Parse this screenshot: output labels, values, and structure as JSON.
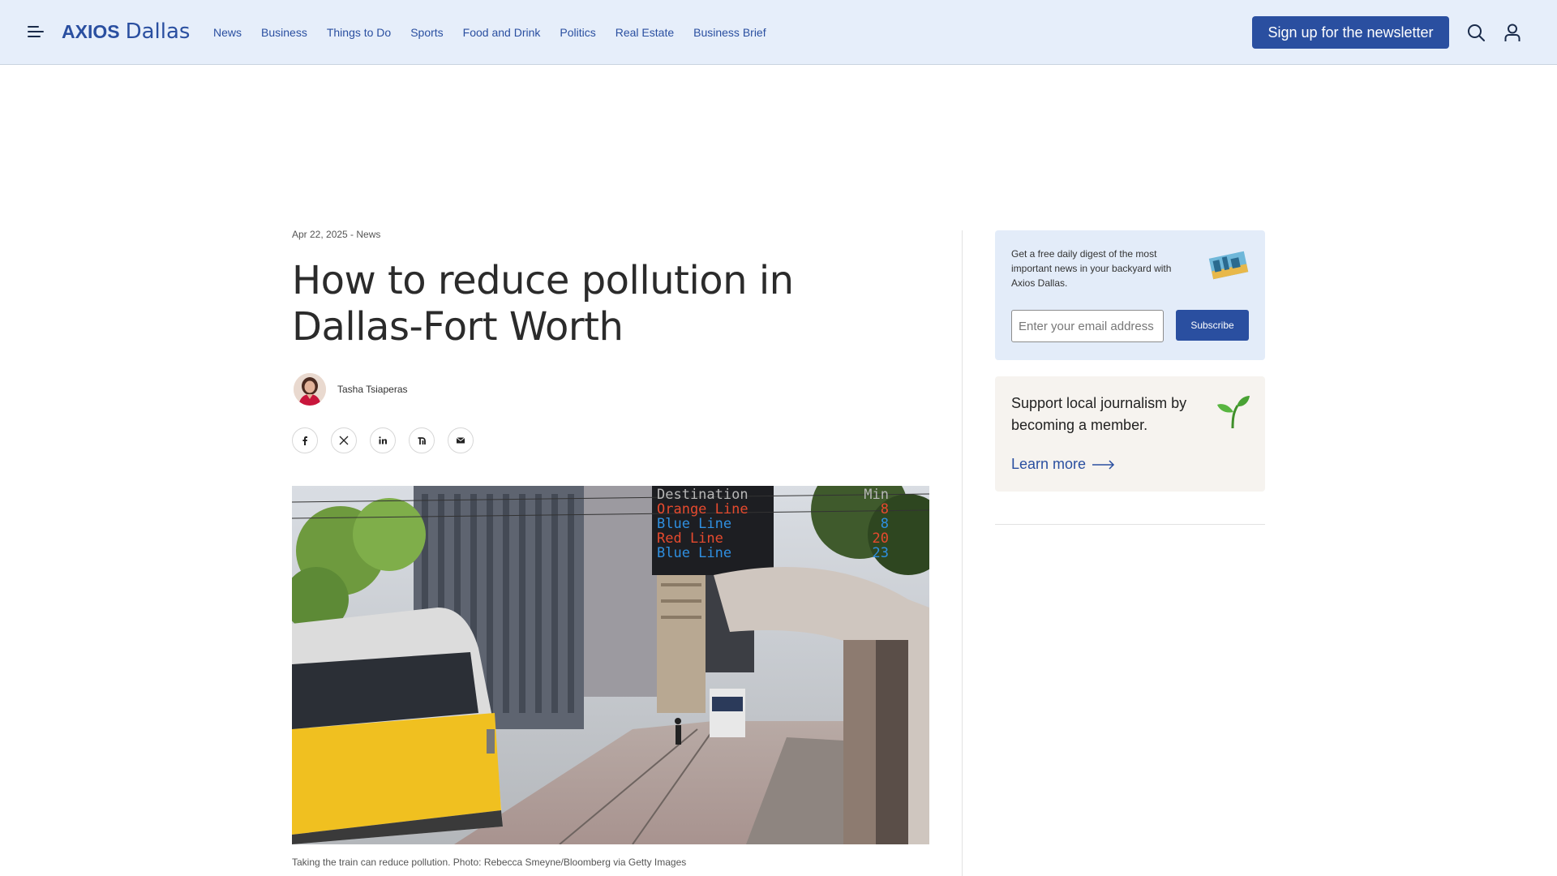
{
  "header": {
    "logo_brand": "AXIOS",
    "logo_city": "Dallas",
    "nav": [
      "News",
      "Business",
      "Things to Do",
      "Sports",
      "Food and Drink",
      "Politics",
      "Real Estate",
      "Business Brief"
    ],
    "signup_label": "Sign up for the newsletter",
    "icons": [
      "menu-icon",
      "search-icon",
      "user-icon"
    ]
  },
  "article": {
    "date": "Apr 22, 2025",
    "separator": " - ",
    "section": "News",
    "title": "How to reduce pollution in Dallas-Fort Worth",
    "author": "Tasha Tsiaperas",
    "share_icons": [
      "facebook-icon",
      "x-icon",
      "linkedin-icon",
      "threads-icon",
      "email-icon"
    ],
    "caption": "Taking the train can reduce pollution. Photo: Rebecca Smeyne/Bloomberg via Getty Images",
    "image_board": {
      "header": "Destination",
      "header_right": "Min",
      "rows": [
        {
          "line": "Orange Line",
          "min": "8",
          "color": "#e64a2e"
        },
        {
          "line": "Blue Line",
          "min": "8",
          "color": "#2f8fe0"
        },
        {
          "line": "Red Line",
          "min": "20",
          "color": "#e64a2e"
        },
        {
          "line": "Blue Line",
          "min": "23",
          "color": "#2f8fe0"
        }
      ]
    }
  },
  "sidebar": {
    "newsletter": {
      "text": "Get a free daily digest of the most important news in your backyard with Axios Dallas.",
      "input_placeholder": "Enter your email address",
      "button": "Subscribe"
    },
    "membership": {
      "text": "Support local journalism by becoming a member.",
      "link": "Learn more"
    }
  },
  "colors": {
    "brand": "#2a4fa0",
    "header_bg": "#e6eefa",
    "newsletter_bg": "#e3ecf9",
    "member_bg": "#f6f3ef"
  }
}
